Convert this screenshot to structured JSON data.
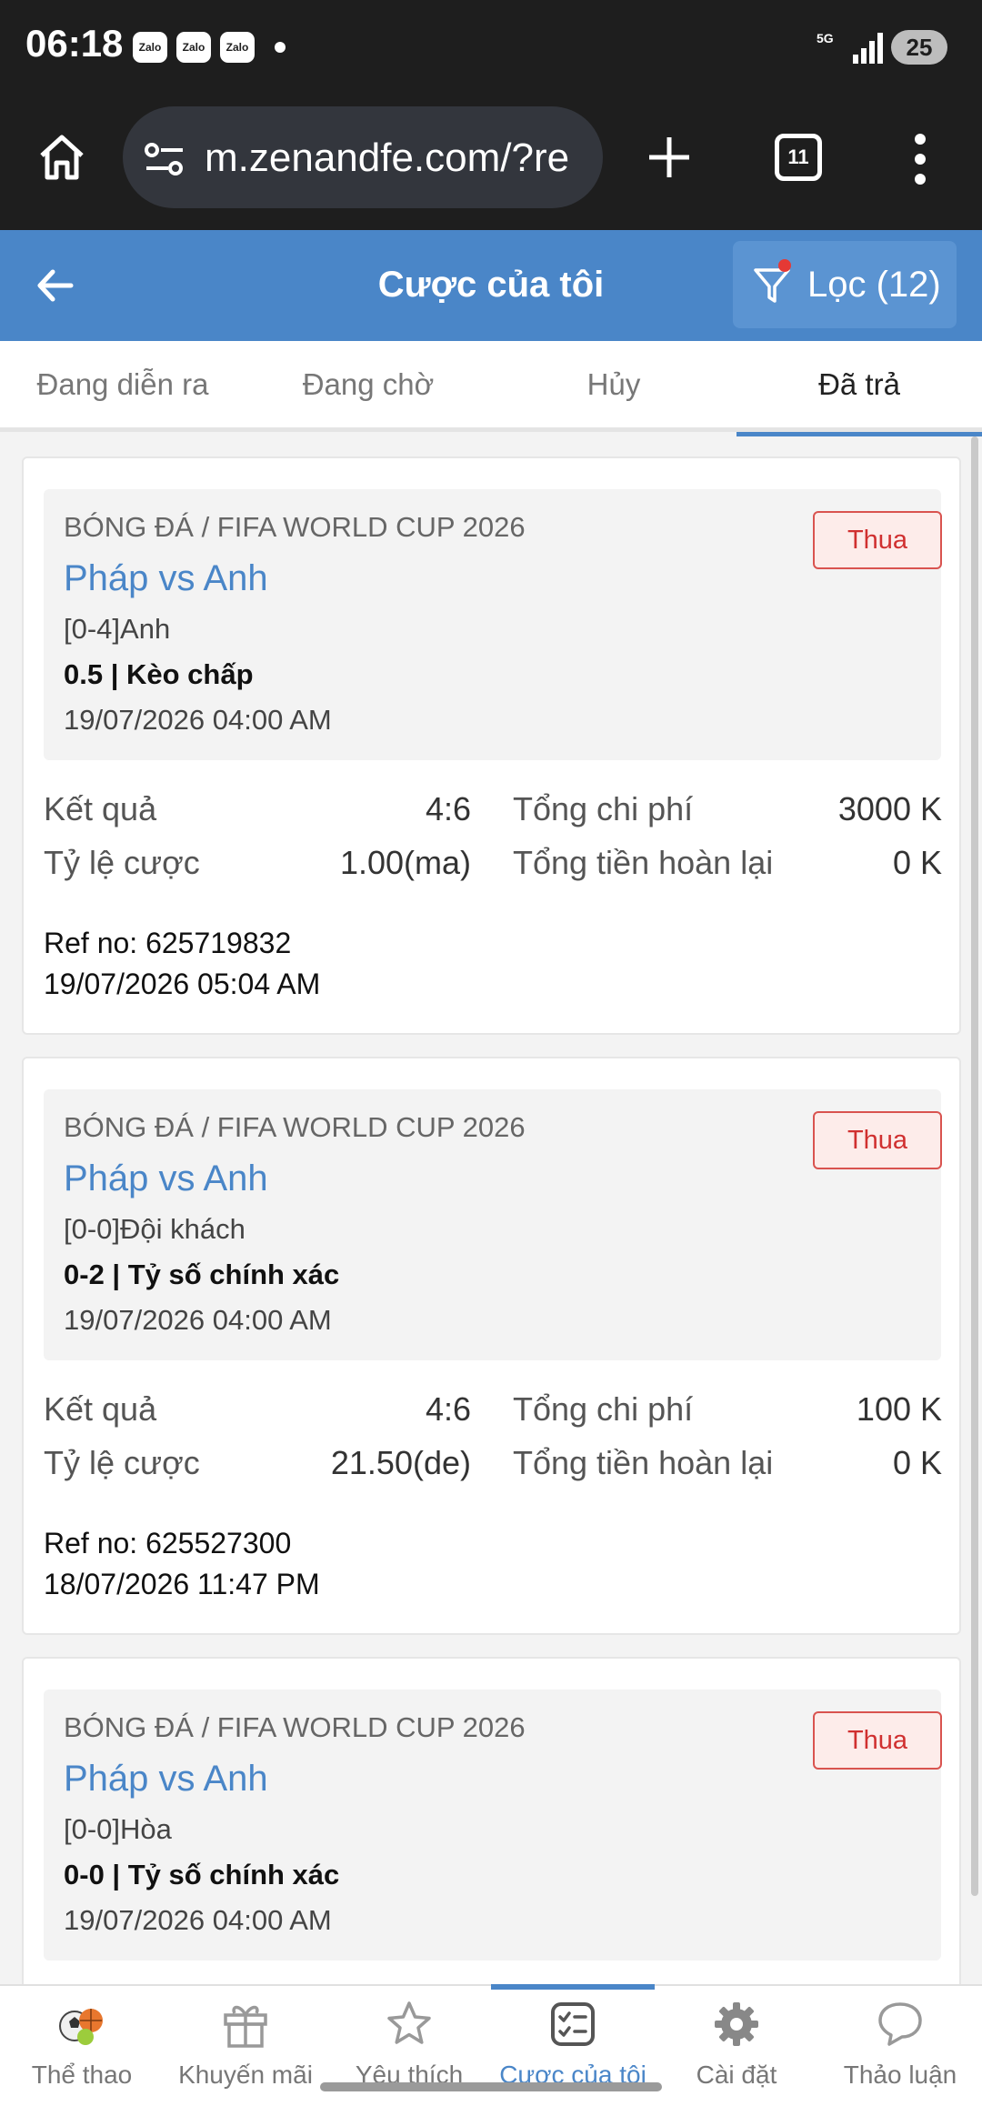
{
  "status_bar": {
    "time": "06:18",
    "notifications": [
      "Zalo",
      "Zalo",
      "Zalo"
    ],
    "network": "5G",
    "battery": "25"
  },
  "browser": {
    "url": "m.zenandfe.com/?re",
    "tab_count": "11",
    "icons": [
      "home-icon",
      "site-settings-icon",
      "plus-icon",
      "tabs-icon",
      "more-vert-icon"
    ]
  },
  "header": {
    "title": "Cược của tôi",
    "filter_label": "Lọc (12)",
    "accent": "#4a86c8"
  },
  "tabs": [
    {
      "label": "Đang diễn ra",
      "active": false
    },
    {
      "label": "Đang chờ",
      "active": false
    },
    {
      "label": "Hủy",
      "active": false
    },
    {
      "label": "Đã trả",
      "active": true
    }
  ],
  "labels": {
    "result": "Kết quả",
    "total_cost": "Tổng chi phí",
    "odds": "Tỷ lệ cược",
    "total_refund": "Tổng tiền hoàn lại"
  },
  "bets": [
    {
      "league": "BÓNG ĐÁ / FIFA WORLD CUP 2026",
      "match": "Pháp vs Anh",
      "pick": "[0-4]Anh",
      "market": "0.5 | Kèo chấp",
      "match_time": "19/07/2026 04:00 AM",
      "status": "Thua",
      "result": "4:6",
      "odds": "1.00(ma)",
      "total_cost": "3000 K",
      "total_refund": "0 K",
      "ref": "Ref no: 625719832",
      "placed_time": "19/07/2026 05:04 AM"
    },
    {
      "league": "BÓNG ĐÁ / FIFA WORLD CUP 2026",
      "match": "Pháp vs Anh",
      "pick": "[0-0]Đội khách",
      "market": "0-2 | Tỷ số chính xác",
      "match_time": "19/07/2026 04:00 AM",
      "status": "Thua",
      "result": "4:6",
      "odds": "21.50(de)",
      "total_cost": "100 K",
      "total_refund": "0 K",
      "ref": "Ref no: 625527300",
      "placed_time": "18/07/2026 11:47 PM"
    },
    {
      "league": "BÓNG ĐÁ / FIFA WORLD CUP 2026",
      "match": "Pháp vs Anh",
      "pick": "[0-0]Hòa",
      "market": "0-0 | Tỷ số chính xác",
      "match_time": "19/07/2026 04:00 AM",
      "status": "Thua"
    }
  ],
  "bottom_nav": [
    {
      "label": "Thể thao",
      "icon": "sports-balls-icon",
      "active": false
    },
    {
      "label": "Khuyến mãi",
      "icon": "gift-icon",
      "active": false
    },
    {
      "label": "Yêu thích",
      "icon": "star-icon",
      "active": false
    },
    {
      "label": "Cược của tôi",
      "icon": "bet-slip-icon",
      "active": true
    },
    {
      "label": "Cài đặt",
      "icon": "gear-icon",
      "active": false
    },
    {
      "label": "Thảo luận",
      "icon": "chat-bubble-icon",
      "active": false
    }
  ]
}
